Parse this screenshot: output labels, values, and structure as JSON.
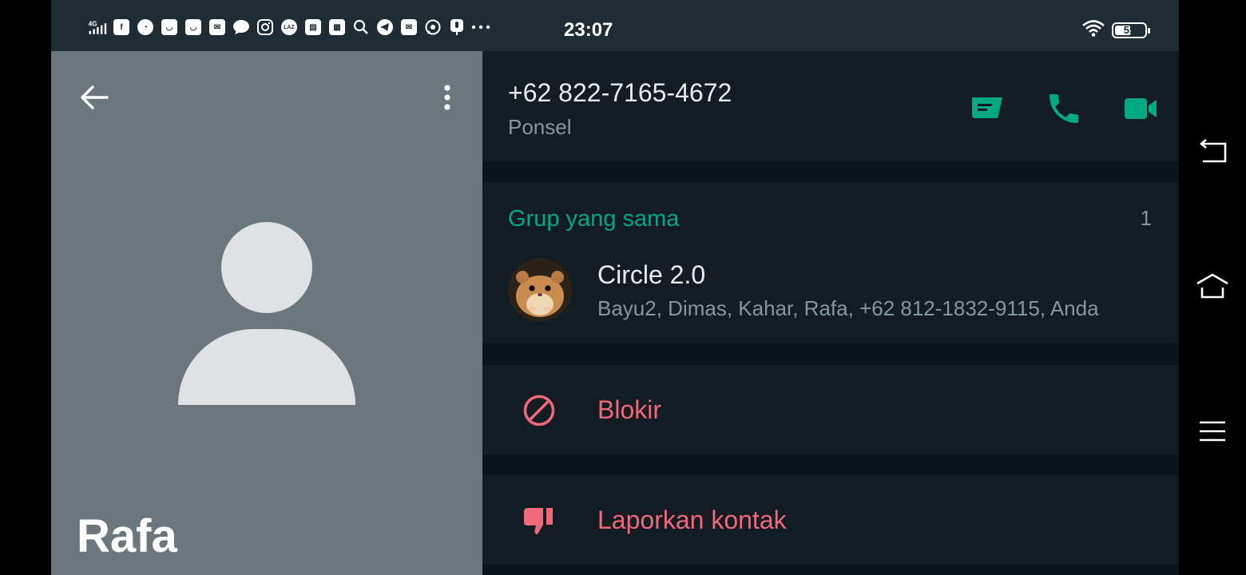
{
  "status_bar": {
    "signal": "4G",
    "notification_icons": [
      "facebook-icon",
      "speedometer-icon",
      "shopping-bag-icon",
      "shopping-bag-icon",
      "mail-icon",
      "chat-bubble-icon",
      "instagram-icon",
      "lazada-icon",
      "mail-box-icon",
      "news-icon",
      "search-icon",
      "telegram-icon",
      "mail-icon",
      "whatsapp-icon",
      "microphone-icon",
      "more-dots-icon"
    ],
    "lazada_label": "LAZ",
    "time": "23:07",
    "battery": 55,
    "battery_label": "55"
  },
  "contact": {
    "name": "Rafa"
  },
  "phone": {
    "number": "+62 822-7165-4672",
    "type": "Ponsel"
  },
  "colors": {
    "accent": "#00a884",
    "danger": "#ef697a",
    "header_bg": "#1f2c34",
    "card_bg": "#121c22",
    "photo_bg": "#6b777c"
  },
  "groups": {
    "title": "Grup yang sama",
    "count": "1",
    "items": [
      {
        "name": "Circle 2.0",
        "members": "Bayu2, Dimas, Kahar, Rafa, +62 812-1832-9115, Anda"
      }
    ]
  },
  "actions": {
    "block": "Blokir",
    "report": "Laporkan kontak"
  }
}
